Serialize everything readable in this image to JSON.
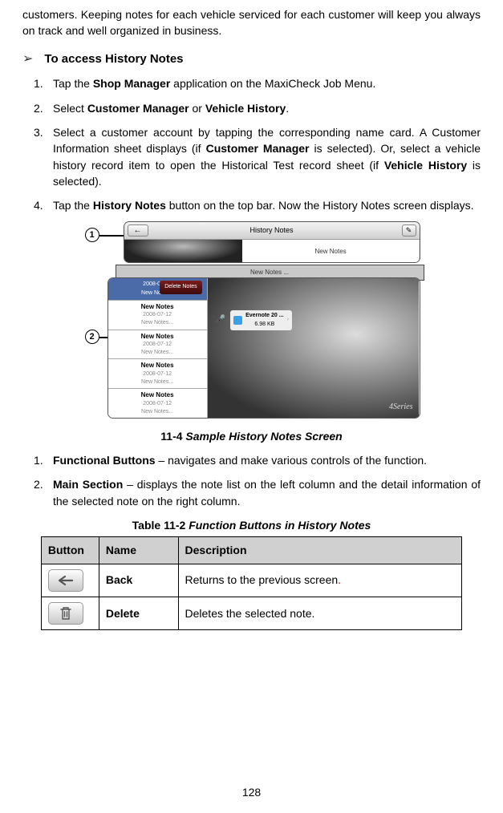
{
  "intro": "customers. Keeping notes for each vehicle serviced for each customer will keep you always on track and well organized in business.",
  "section": {
    "title": "To access History Notes"
  },
  "steps": {
    "s1": {
      "n": "1.",
      "pre": "Tap the ",
      "b1": "Shop Manager",
      "post": " application on the MaxiCheck Job Menu."
    },
    "s2": {
      "n": "2.",
      "pre": "Select ",
      "b1": "Customer Manager",
      "mid": " or ",
      "b2": "Vehicle History",
      "post": "."
    },
    "s3": {
      "n": "3.",
      "t1": "Select a customer account by tapping the corresponding name card. A Customer Information sheet displays (if ",
      "b1": "Customer Manager",
      "t2": " is selected). Or, select a vehicle history record item to open the Historical Test record sheet (if ",
      "b2": "Vehicle History",
      "t3": " is selected)."
    },
    "s4": {
      "n": "4.",
      "t1": "Tap the ",
      "b1": "History Notes",
      "t2": " button on the top bar. Now the History Notes screen displays."
    }
  },
  "figure": {
    "callout1": "1",
    "callout2": "2",
    "header": "History Notes",
    "newNotes": "New Notes",
    "newNotesDots": "New Notes ...",
    "delete": "Delete Notes",
    "date": "2008-07-12",
    "sub": "New Notes...",
    "attachName": "Evernote 20 ...",
    "attachSize": "6.98 KB",
    "back": "←",
    "pencil": "✎",
    "brand": "4Series"
  },
  "figCaption": {
    "num": "11-4 ",
    "title": "Sample History Notes Screen"
  },
  "desc": {
    "d1": {
      "n": "1.",
      "b": "Functional Buttons",
      "t": " – navigates and make various controls of the function."
    },
    "d2": {
      "n": "2.",
      "b": "Main Section",
      "t": " – displays the note list on the left column and the detail information of the selected note on the right column."
    }
  },
  "tableCaption": {
    "num": "Table 11-2 ",
    "title": "Function Buttons in History Notes"
  },
  "table": {
    "h1": "Button",
    "h2": "Name",
    "h3": "Description",
    "r1": {
      "name": "Back",
      "desc": "Returns to the previous screen",
      "period": "."
    },
    "r2": {
      "name": "Delete",
      "desc": "Deletes the selected note."
    }
  },
  "pageNumber": "128"
}
